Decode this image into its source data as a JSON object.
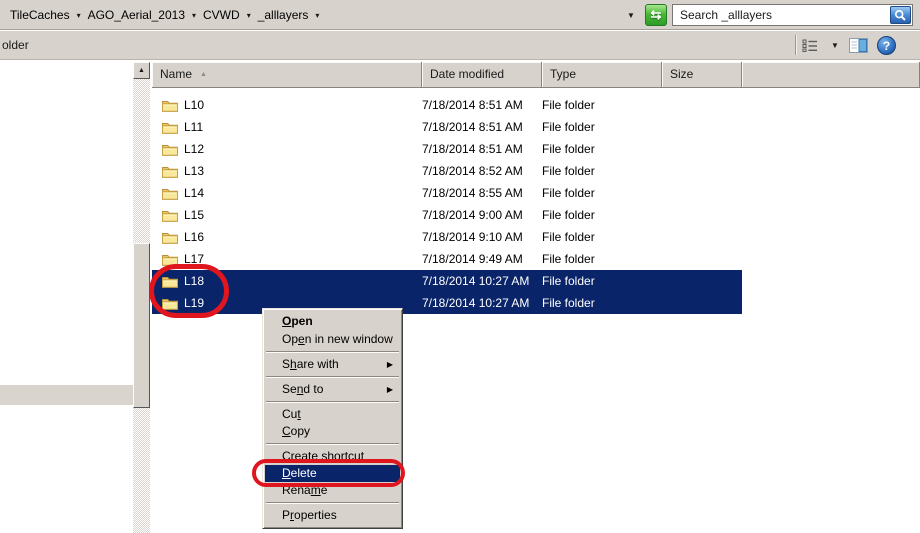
{
  "window": {
    "breadcrumb": {
      "items": [
        "TileCaches",
        "AGO_Aerial_2013",
        "CVWD",
        "_alllayers"
      ]
    },
    "search": {
      "placeholder": "Search _alllayers"
    },
    "command_bar": {
      "left_text": "older"
    },
    "colors": {
      "selection": "#0a246a",
      "annotation_red": "#e0161f",
      "chrome_gray": "#d7d3cc"
    },
    "icons": {
      "refresh": "refresh-arrows",
      "search": "magnifier",
      "views": "details-view",
      "views_dropdown": "chevron-down",
      "preview": "preview-pane",
      "help": "question-mark",
      "sort": "sort-ascending-arrow",
      "scroll_up": "scroll-up-arrow",
      "folder": "yellow-folder"
    }
  },
  "file_list": {
    "columns": [
      {
        "label": "Name",
        "sort": "asc"
      },
      {
        "label": "Date modified",
        "sort": null
      },
      {
        "label": "Type",
        "sort": null
      },
      {
        "label": "Size",
        "sort": null
      }
    ],
    "rows": [
      {
        "name": "L10",
        "date_modified": "7/18/2014 8:51 AM",
        "type": "File folder",
        "size": "",
        "selected": false
      },
      {
        "name": "L11",
        "date_modified": "7/18/2014 8:51 AM",
        "type": "File folder",
        "size": "",
        "selected": false
      },
      {
        "name": "L12",
        "date_modified": "7/18/2014 8:51 AM",
        "type": "File folder",
        "size": "",
        "selected": false
      },
      {
        "name": "L13",
        "date_modified": "7/18/2014 8:52 AM",
        "type": "File folder",
        "size": "",
        "selected": false
      },
      {
        "name": "L14",
        "date_modified": "7/18/2014 8:55 AM",
        "type": "File folder",
        "size": "",
        "selected": false
      },
      {
        "name": "L15",
        "date_modified": "7/18/2014 9:00 AM",
        "type": "File folder",
        "size": "",
        "selected": false
      },
      {
        "name": "L16",
        "date_modified": "7/18/2014 9:10 AM",
        "type": "File folder",
        "size": "",
        "selected": false
      },
      {
        "name": "L17",
        "date_modified": "7/18/2014 9:49 AM",
        "type": "File folder",
        "size": "",
        "selected": false
      },
      {
        "name": "L18",
        "date_modified": "7/18/2014 10:27 AM",
        "type": "File folder",
        "size": "",
        "selected": true
      },
      {
        "name": "L19",
        "date_modified": "7/18/2014 10:27 AM",
        "type": "File folder",
        "size": "",
        "selected": true
      }
    ]
  },
  "context_menu": {
    "items": [
      {
        "type": "item",
        "label": "Open",
        "underline": 0,
        "bold": true
      },
      {
        "type": "item",
        "label": "Open in new window",
        "underline": 2
      },
      {
        "type": "separator"
      },
      {
        "type": "item",
        "label": "Share with",
        "underline": 1,
        "submenu": true
      },
      {
        "type": "separator"
      },
      {
        "type": "item",
        "label": "Send to",
        "underline": 2,
        "submenu": true
      },
      {
        "type": "separator"
      },
      {
        "type": "item",
        "label": "Cut",
        "underline": 2
      },
      {
        "type": "item",
        "label": "Copy",
        "underline": 0
      },
      {
        "type": "separator"
      },
      {
        "type": "item",
        "label": "Create shortcut",
        "underline": null
      },
      {
        "type": "item",
        "label": "Delete",
        "underline": 0,
        "highlighted": true
      },
      {
        "type": "item",
        "label": "Rename",
        "underline": 4
      },
      {
        "type": "separator"
      },
      {
        "type": "item",
        "label": "Properties",
        "underline": 1
      }
    ]
  }
}
